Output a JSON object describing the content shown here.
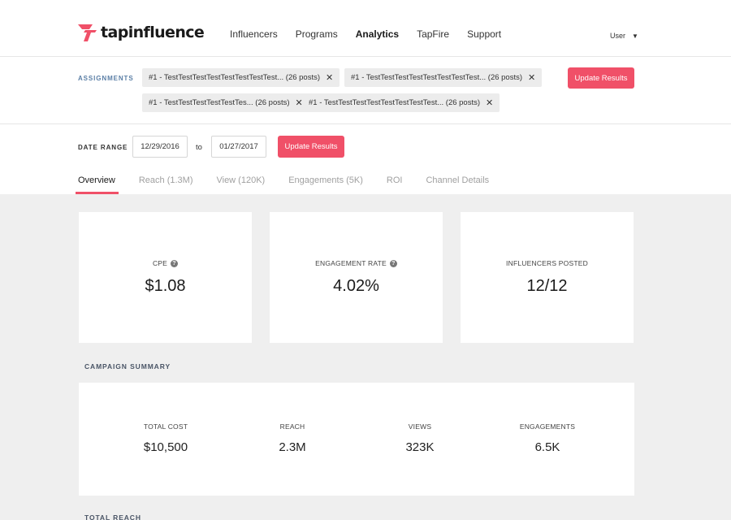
{
  "brand": {
    "name": "tapinfluence",
    "accent": "#f05068"
  },
  "nav": {
    "items": [
      {
        "label": "Influencers",
        "active": false
      },
      {
        "label": "Programs",
        "active": false
      },
      {
        "label": "Analytics",
        "active": true
      },
      {
        "label": "TapFire",
        "active": false
      },
      {
        "label": "Support",
        "active": false
      }
    ],
    "user": "User",
    "user_caret": "▼"
  },
  "assignments": {
    "label": "ASSIGNMENTS",
    "chips": [
      "#1 - TestTestTestTestTestTestTestTest... (26 posts)",
      "#1 - TestTestTestTestTestTestTestTest... (26 posts)",
      "#1 - TestTestTestTestTestTes... (26 posts)",
      "#1 - TestTestTestTestTestTestTestTest... (26 posts)"
    ],
    "remove_glyph": "✕",
    "update_label": "Update Results"
  },
  "date_range": {
    "label": "DATE RANGE",
    "start": "12/29/2016",
    "separator": "to",
    "end": "01/27/2017",
    "update_label": "Update Results"
  },
  "tabs": [
    {
      "label": "Overview",
      "active": true
    },
    {
      "label": "Reach (1.3M)",
      "active": false
    },
    {
      "label": "View (120K)",
      "active": false
    },
    {
      "label": "Engagements (5K)",
      "active": false
    },
    {
      "label": "ROI",
      "active": false
    },
    {
      "label": "Channel Details",
      "active": false
    }
  ],
  "metrics": [
    {
      "label": "CPE",
      "value": "$1.08",
      "help": true
    },
    {
      "label": "ENGAGEMENT RATE",
      "value": "4.02%",
      "help": true
    },
    {
      "label": "INFLUENCERS POSTED",
      "value": "12/12",
      "help": false
    }
  ],
  "help_glyph": "?",
  "campaign_summary": {
    "title": "CAMPAIGN SUMMARY",
    "items": [
      {
        "label": "TOTAL COST",
        "value": "$10,500"
      },
      {
        "label": "REACH",
        "value": "2.3M"
      },
      {
        "label": "VIEWS",
        "value": "323K"
      },
      {
        "label": "ENGAGEMENTS",
        "value": "6.5K"
      }
    ]
  },
  "total_reach": {
    "title": "TOTAL REACH"
  }
}
